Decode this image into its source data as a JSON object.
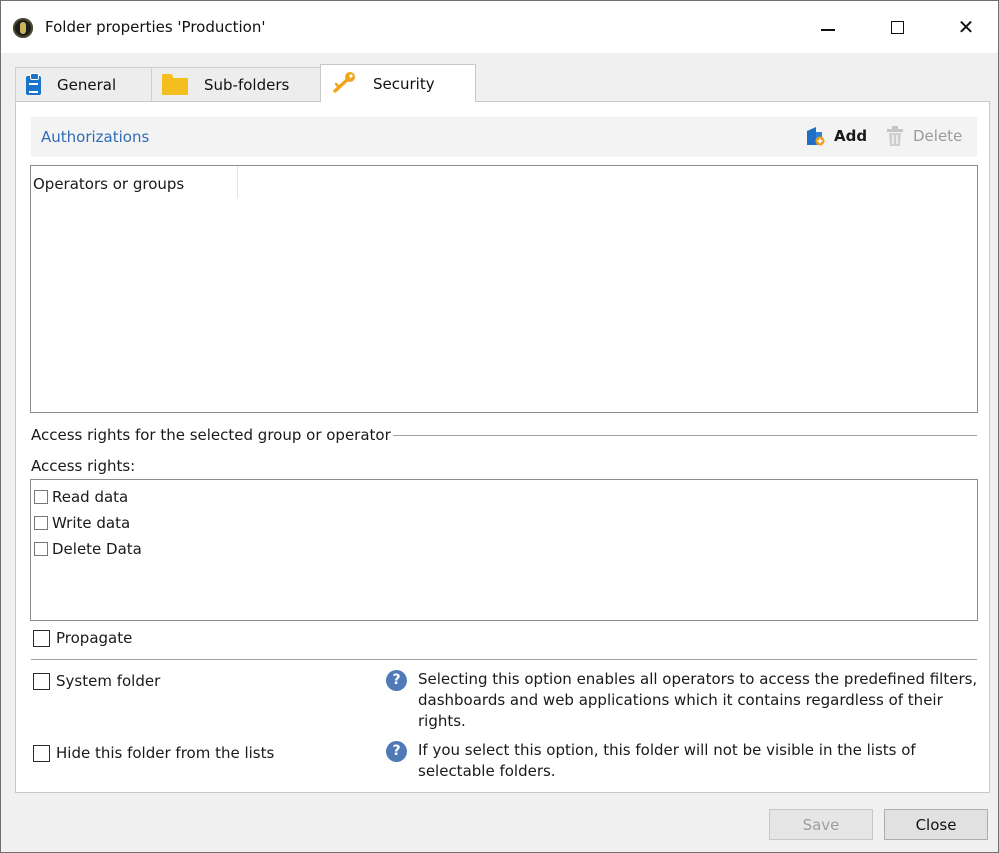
{
  "window": {
    "title": "Folder properties 'Production'"
  },
  "tabs": [
    {
      "label": "General",
      "icon": "clipboard-icon"
    },
    {
      "label": "Sub-folders",
      "icon": "folder-icon"
    },
    {
      "label": "Security",
      "icon": "key-icon",
      "active": true
    }
  ],
  "authorizations": {
    "title": "Authorizations",
    "add_label": "Add",
    "delete_label": "Delete",
    "column_header": "Operators or groups"
  },
  "access": {
    "section_label": "Access rights for the selected group or operator",
    "rights_label": "Access rights:",
    "rights": [
      {
        "label": "Read data",
        "checked": false
      },
      {
        "label": "Write data",
        "checked": false
      },
      {
        "label": "Delete Data",
        "checked": false
      }
    ],
    "propagate_label": "Propagate"
  },
  "options": {
    "system_folder_label": "System folder",
    "system_folder_help": "Selecting this option enables all operators to access the predefined filters, dashboards and web applications which it contains regardless of their rights.",
    "hide_folder_label": "Hide this folder from the lists",
    "hide_folder_help": "If you select this option, this folder will not be visible in the lists of selectable folders."
  },
  "footer": {
    "save_label": "Save",
    "close_label": "Close"
  },
  "colors": {
    "accent_blue": "#2f6cb5",
    "help_icon": "#4f7ab7",
    "folder_yellow": "#f4bf1e",
    "key_orange": "#f0a619",
    "clipboard_blue": "#1a74c9"
  }
}
